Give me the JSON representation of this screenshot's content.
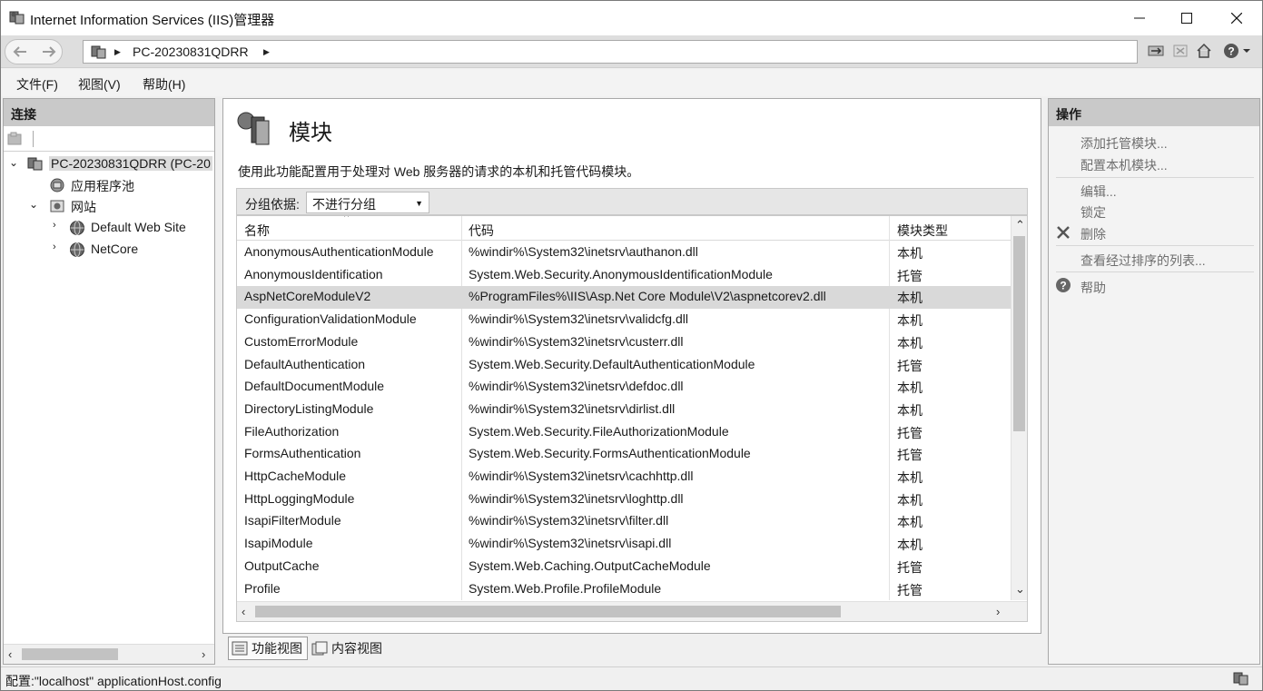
{
  "window": {
    "title": "Internet Information Services (IIS)管理器",
    "icon": "iis-manager-icon",
    "controls": {
      "minimize": "minimize-icon",
      "maximize": "maximize-icon",
      "close": "close-icon"
    }
  },
  "address": {
    "path_item": "PC-20230831QDRR",
    "toolbar_icons": [
      "connect-icon",
      "stop-icon",
      "home-icon",
      "help-icon"
    ]
  },
  "menu": [
    "文件(F)",
    "视图(V)",
    "帮助(H)"
  ],
  "connections": {
    "title": "连接",
    "tree": [
      {
        "label": "PC-20230831QDRR (PC-20",
        "icon": "server-icon"
      },
      {
        "label": "应用程序池",
        "icon": "app-pool-icon"
      },
      {
        "label": "网站",
        "icon": "sites-icon"
      },
      {
        "label": "Default Web Site",
        "icon": "globe-icon"
      },
      {
        "label": "NetCore",
        "icon": "globe-icon"
      }
    ]
  },
  "center": {
    "title": "模块",
    "description": "使用此功能配置用于处理对 Web 服务器的请求的本机和托管代码模块。",
    "group_label": "分组依据:",
    "group_value": "不进行分组",
    "columns": [
      "名称",
      "代码",
      "模块类型"
    ],
    "selected_row": 2,
    "rows": [
      [
        "AnonymousAuthenticationModule",
        "%windir%\\System32\\inetsrv\\authanon.dll",
        "本机"
      ],
      [
        "AnonymousIdentification",
        "System.Web.Security.AnonymousIdentificationModule",
        "托管"
      ],
      [
        "AspNetCoreModuleV2",
        "%ProgramFiles%\\IIS\\Asp.Net Core Module\\V2\\aspnetcorev2.dll",
        "本机"
      ],
      [
        "ConfigurationValidationModule",
        "%windir%\\System32\\inetsrv\\validcfg.dll",
        "本机"
      ],
      [
        "CustomErrorModule",
        "%windir%\\System32\\inetsrv\\custerr.dll",
        "本机"
      ],
      [
        "DefaultAuthentication",
        "System.Web.Security.DefaultAuthenticationModule",
        "托管"
      ],
      [
        "DefaultDocumentModule",
        "%windir%\\System32\\inetsrv\\defdoc.dll",
        "本机"
      ],
      [
        "DirectoryListingModule",
        "%windir%\\System32\\inetsrv\\dirlist.dll",
        "本机"
      ],
      [
        "FileAuthorization",
        "System.Web.Security.FileAuthorizationModule",
        "托管"
      ],
      [
        "FormsAuthentication",
        "System.Web.Security.FormsAuthenticationModule",
        "托管"
      ],
      [
        "HttpCacheModule",
        "%windir%\\System32\\inetsrv\\cachhttp.dll",
        "本机"
      ],
      [
        "HttpLoggingModule",
        "%windir%\\System32\\inetsrv\\loghttp.dll",
        "本机"
      ],
      [
        "IsapiFilterModule",
        "%windir%\\System32\\inetsrv\\filter.dll",
        "本机"
      ],
      [
        "IsapiModule",
        "%windir%\\System32\\inetsrv\\isapi.dll",
        "本机"
      ],
      [
        "OutputCache",
        "System.Web.Caching.OutputCacheModule",
        "托管"
      ],
      [
        "Profile",
        "System.Web.Profile.ProfileModule",
        "托管"
      ]
    ],
    "view_tabs": [
      {
        "label": "功能视图",
        "icon": "features-view-icon"
      },
      {
        "label": "内容视图",
        "icon": "content-view-icon"
      }
    ]
  },
  "actions": {
    "title": "操作",
    "items": [
      {
        "label": "添加托管模块...",
        "icon": ""
      },
      {
        "label": "配置本机模块...",
        "icon": ""
      },
      {
        "label": "编辑...",
        "icon": ""
      },
      {
        "label": "锁定",
        "icon": ""
      },
      {
        "label": "删除",
        "icon": "delete-icon"
      },
      {
        "label": "查看经过排序的列表...",
        "icon": ""
      },
      {
        "label": "帮助",
        "icon": "help-icon"
      }
    ]
  },
  "status": {
    "text": "配置:\"localhost\" applicationHost.config"
  }
}
